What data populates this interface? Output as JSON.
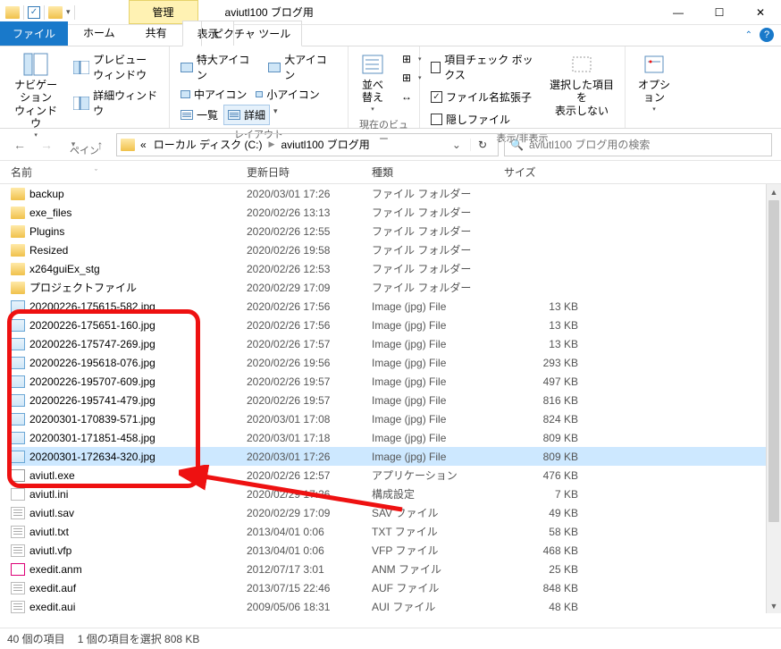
{
  "window": {
    "title": "aviutl100 ブログ用",
    "manage_tab": "管理"
  },
  "tabs": {
    "file": "ファイル",
    "home": "ホーム",
    "share": "共有",
    "view": "表示",
    "context": "ピクチャ ツール"
  },
  "ribbon": {
    "pane": {
      "nav": "ナビゲーション\nウィンドウ",
      "preview": "プレビュー ウィンドウ",
      "details": "詳細ウィンドウ",
      "label": "ペイン"
    },
    "layout": {
      "xl_icon": "特大アイコン",
      "l_icon": "大アイコン",
      "m_icon": "中アイコン",
      "s_icon": "小アイコン",
      "list": "一覧",
      "details": "詳細",
      "label": "レイアウト"
    },
    "currentview": {
      "sort": "並べ替え",
      "label": "現在のビュー"
    },
    "showhide": {
      "chk1": "項目チェック ボックス",
      "chk2": "ファイル名拡張子",
      "chk3": "隠しファイル",
      "hide_selected": "選択した項目を\n表示しない",
      "label": "表示/非表示"
    },
    "options": {
      "label": "オプション"
    }
  },
  "address": {
    "prefix": "«",
    "disk": "ローカル ディスク (C:)",
    "folder": "aviutl100 ブログ用",
    "search_placeholder": "aviutl100 ブログ用の検索"
  },
  "columns": {
    "name": "名前",
    "date": "更新日時",
    "type": "種類",
    "size": "サイズ"
  },
  "files": [
    {
      "icon": "folder",
      "name": "backup",
      "date": "2020/03/01 17:26",
      "type": "ファイル フォルダー",
      "size": ""
    },
    {
      "icon": "folder",
      "name": "exe_files",
      "date": "2020/02/26 13:13",
      "type": "ファイル フォルダー",
      "size": ""
    },
    {
      "icon": "folder",
      "name": "Plugins",
      "date": "2020/02/26 12:55",
      "type": "ファイル フォルダー",
      "size": ""
    },
    {
      "icon": "folder",
      "name": "Resized",
      "date": "2020/02/26 19:58",
      "type": "ファイル フォルダー",
      "size": ""
    },
    {
      "icon": "folder",
      "name": "x264guiEx_stg",
      "date": "2020/02/26 12:53",
      "type": "ファイル フォルダー",
      "size": ""
    },
    {
      "icon": "folder",
      "name": "プロジェクトファイル",
      "date": "2020/02/29 17:09",
      "type": "ファイル フォルダー",
      "size": ""
    },
    {
      "icon": "img",
      "name": "20200226-175615-582.jpg",
      "date": "2020/02/26 17:56",
      "type": "Image (jpg) File",
      "size": "13 KB"
    },
    {
      "icon": "img",
      "name": "20200226-175651-160.jpg",
      "date": "2020/02/26 17:56",
      "type": "Image (jpg) File",
      "size": "13 KB"
    },
    {
      "icon": "img",
      "name": "20200226-175747-269.jpg",
      "date": "2020/02/26 17:57",
      "type": "Image (jpg) File",
      "size": "13 KB"
    },
    {
      "icon": "img",
      "name": "20200226-195618-076.jpg",
      "date": "2020/02/26 19:56",
      "type": "Image (jpg) File",
      "size": "293 KB"
    },
    {
      "icon": "img",
      "name": "20200226-195707-609.jpg",
      "date": "2020/02/26 19:57",
      "type": "Image (jpg) File",
      "size": "497 KB"
    },
    {
      "icon": "img",
      "name": "20200226-195741-479.jpg",
      "date": "2020/02/26 19:57",
      "type": "Image (jpg) File",
      "size": "816 KB"
    },
    {
      "icon": "img",
      "name": "20200301-170839-571.jpg",
      "date": "2020/03/01 17:08",
      "type": "Image (jpg) File",
      "size": "824 KB"
    },
    {
      "icon": "img",
      "name": "20200301-171851-458.jpg",
      "date": "2020/03/01 17:18",
      "type": "Image (jpg) File",
      "size": "809 KB"
    },
    {
      "icon": "img",
      "name": "20200301-172634-320.jpg",
      "date": "2020/03/01 17:26",
      "type": "Image (jpg) File",
      "size": "809 KB",
      "selected": true
    },
    {
      "icon": "exe",
      "name": "aviutl.exe",
      "date": "2020/02/26 12:57",
      "type": "アプリケーション",
      "size": "476 KB"
    },
    {
      "icon": "cfg",
      "name": "aviutl.ini",
      "date": "2020/02/29 17:26",
      "type": "構成設定",
      "size": "7 KB"
    },
    {
      "icon": "txt",
      "name": "aviutl.sav",
      "date": "2020/02/29 17:09",
      "type": "SAV ファイル",
      "size": "49 KB"
    },
    {
      "icon": "txt",
      "name": "aviutl.txt",
      "date": "2013/04/01 0:06",
      "type": "TXT ファイル",
      "size": "58 KB"
    },
    {
      "icon": "txt",
      "name": "aviutl.vfp",
      "date": "2013/04/01 0:06",
      "type": "VFP ファイル",
      "size": "468 KB"
    },
    {
      "icon": "anm",
      "name": "exedit.anm",
      "date": "2012/07/17 3:01",
      "type": "ANM ファイル",
      "size": "25 KB"
    },
    {
      "icon": "txt",
      "name": "exedit.auf",
      "date": "2013/07/15 22:46",
      "type": "AUF ファイル",
      "size": "848 KB"
    },
    {
      "icon": "txt",
      "name": "exedit.aui",
      "date": "2009/05/06 18:31",
      "type": "AUI ファイル",
      "size": "48 KB"
    }
  ],
  "status": {
    "count": "40 個の項目",
    "selection": "1 個の項目を選択 808 KB"
  }
}
